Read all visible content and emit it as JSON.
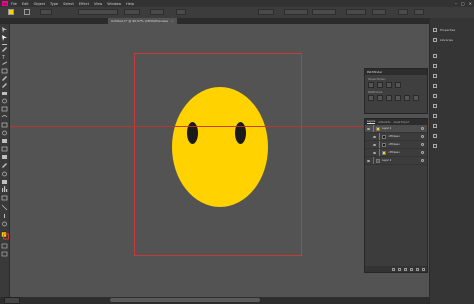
{
  "menubar": {
    "logo": "Ai",
    "items": [
      "File",
      "Edit",
      "Object",
      "Type",
      "Select",
      "Effect",
      "View",
      "Window",
      "Help"
    ]
  },
  "document": {
    "tab_title": "Untitled-1* @ 90.57% (CMYK/Preview)"
  },
  "panels": {
    "pathfinder": {
      "title": "Pathfinder",
      "shape_modes_label": "Shape Modes:",
      "pathfinders_label": "Pathfinders:"
    },
    "layers": {
      "tabs": [
        "Layers",
        "Artboards",
        "Asset Export"
      ],
      "rows": [
        {
          "name": "Layer 1",
          "color": "#3d7cff",
          "selected": true
        },
        {
          "name": "<Ellipse>",
          "color": "#3d7cff",
          "selected": false
        },
        {
          "name": "<Ellipse>",
          "color": "#3d7cff",
          "selected": false
        },
        {
          "name": "<Ellipse>",
          "color": "#3d7cff",
          "selected": false
        },
        {
          "name": "Layer 2",
          "color": "#e83a3a",
          "selected": false
        }
      ]
    }
  },
  "dock": {
    "items": [
      "Properties",
      "Libraries"
    ]
  },
  "colors": {
    "face": "#ffd200",
    "eyes": "#1b1b1b",
    "artboard_border": "#c83a3a",
    "guide": "#c2332f"
  }
}
